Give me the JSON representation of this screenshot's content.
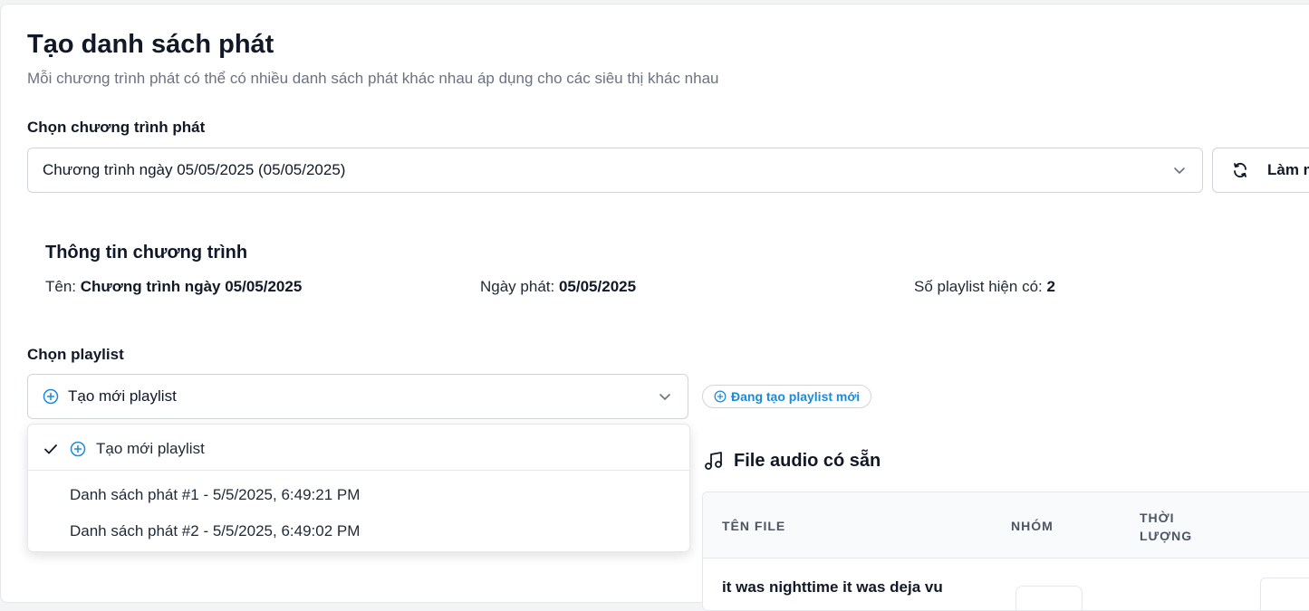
{
  "header": {
    "title": "Tạo danh sách phát",
    "subtitle": "Mỗi chương trình phát có thể có nhiều danh sách phát khác nhau áp dụng cho các siêu thị khác nhau"
  },
  "program_select": {
    "label": "Chọn chương trình phát",
    "value": "Chương trình ngày 05/05/2025 (05/05/2025)",
    "refresh_label": "Làm mới"
  },
  "program_info": {
    "title": "Thông tin chương trình",
    "name_label": "Tên:",
    "name_value": "Chương trình ngày 05/05/2025",
    "date_label": "Ngày phát:",
    "date_value": "05/05/2025",
    "count_label": "Số playlist hiện có:",
    "count_value": "2"
  },
  "playlist_select": {
    "label": "Chọn playlist",
    "value": "Tạo mới playlist",
    "status_badge": "Đang tạo playlist mới",
    "options": [
      {
        "label": "Tạo mới playlist",
        "selected": true
      },
      {
        "label": "Danh sách phát #1 - 5/5/2025, 6:49:21 PM",
        "selected": false
      },
      {
        "label": "Danh sách phát #2 - 5/5/2025, 6:49:02 PM",
        "selected": false
      }
    ]
  },
  "audio_files": {
    "title": "File audio có sẵn",
    "columns": [
      "Tên file",
      "Nhóm",
      "Thời lượng"
    ],
    "rows": [
      {
        "name": "it was nighttime it was deja vu"
      }
    ]
  },
  "colors": {
    "accent": "#1d8ad6",
    "border": "#d1d5db",
    "text": "#111827",
    "muted": "#6b7280"
  },
  "icons": [
    "chevron-down-icon",
    "refresh-icon",
    "plus-circle-icon",
    "check-icon",
    "music-note-icon"
  ]
}
